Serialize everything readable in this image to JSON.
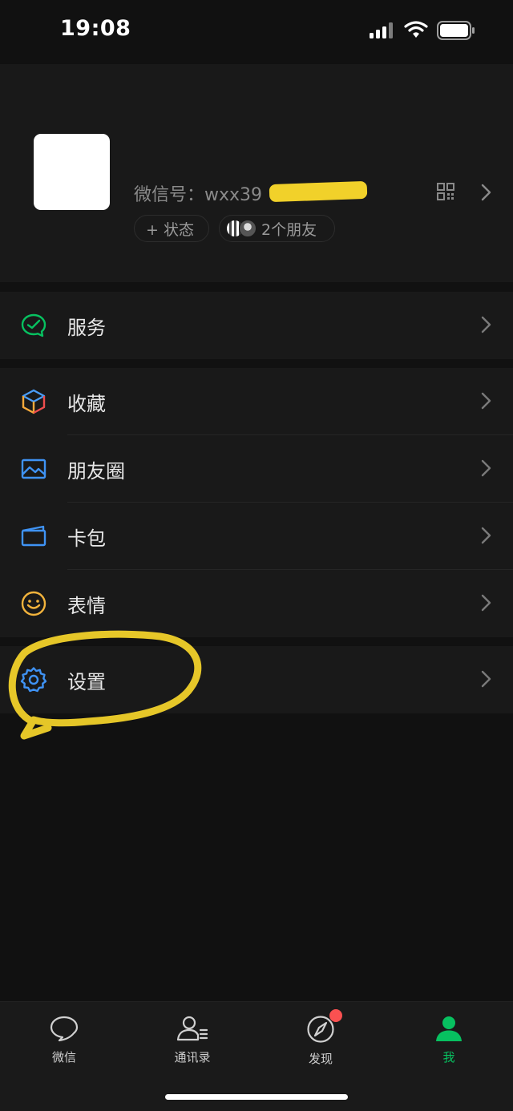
{
  "status_bar": {
    "time": "19:08"
  },
  "profile": {
    "wechat_id_label": "微信号：wxx39",
    "status_button": "+ 状态",
    "friends_label": "2个朋友"
  },
  "menu": {
    "services": "服务",
    "favorites": "收藏",
    "moments": "朋友圈",
    "cards": "卡包",
    "stickers": "表情",
    "settings": "设置"
  },
  "tabbar": {
    "chats": "微信",
    "contacts": "通讯录",
    "discover": "发现",
    "me": "我"
  },
  "colors": {
    "accent_green": "#07c160",
    "highlight_yellow": "#f1d12a",
    "badge_red": "#fa5151"
  },
  "icons": {
    "services": "service-check-icon",
    "favorites": "cube-icon",
    "moments": "picture-icon",
    "cards": "wallet-icon",
    "stickers": "smiley-icon",
    "settings": "gear-icon"
  }
}
